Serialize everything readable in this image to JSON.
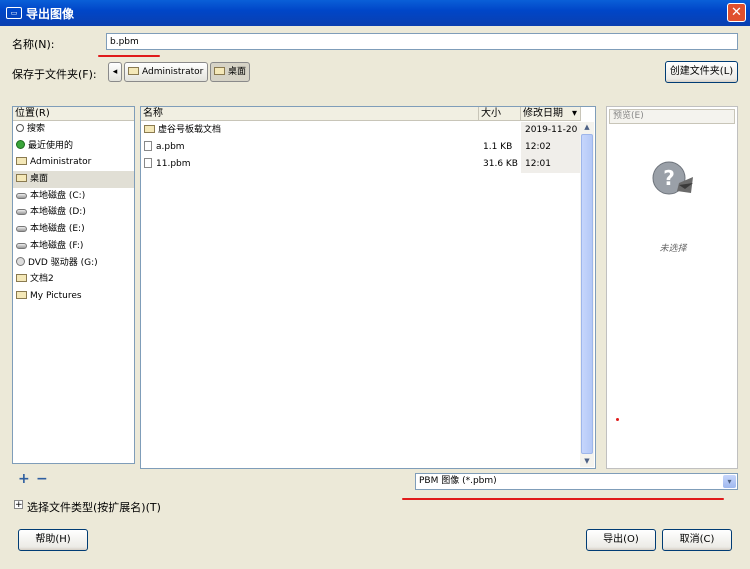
{
  "window": {
    "title": "导出图像",
    "close_glyph": "✕",
    "icon": "dialog-icon"
  },
  "name_label": "名称(N):",
  "name_value": "b.pbm",
  "save_in_label": "保存于文件夹(F):",
  "path": {
    "back_glyph": "◂",
    "items": [
      "Administrator",
      "桌面"
    ]
  },
  "create_folder_label": "创建文件夹(L)",
  "places": {
    "header": "位置(R)",
    "items": [
      {
        "label": "搜索",
        "icon": "search-icon"
      },
      {
        "label": "最近使用的",
        "icon": "recent-icon"
      },
      {
        "label": "Administrator",
        "icon": "folder-icon"
      },
      {
        "label": "桌面",
        "icon": "folder-icon",
        "selected": true
      },
      {
        "label": "本地磁盘 (C:)",
        "icon": "disk-icon"
      },
      {
        "label": "本地磁盘 (D:)",
        "icon": "disk-icon"
      },
      {
        "label": "本地磁盘 (E:)",
        "icon": "disk-icon"
      },
      {
        "label": "本地磁盘 (F:)",
        "icon": "disk-icon"
      },
      {
        "label": "DVD 驱动器 (G:)",
        "icon": "dvd-icon"
      },
      {
        "label": "文档2",
        "icon": "folder-icon"
      },
      {
        "label": "My Pictures",
        "icon": "folder-icon"
      }
    ]
  },
  "files": {
    "headers": {
      "name": "名称",
      "size": "大小",
      "modified": "修改日期",
      "sort_glyph": "▾"
    },
    "rows": [
      {
        "name": "虚谷号板载文档",
        "size": "",
        "modified": "2019-11-20",
        "type": "folder"
      },
      {
        "name": "a.pbm",
        "size": "1.1 KB",
        "modified": "12:02",
        "type": "file"
      },
      {
        "name": "11.pbm",
        "size": "31.6 KB",
        "modified": "12:01",
        "type": "file"
      }
    ]
  },
  "preview": {
    "label": "预览(E)",
    "empty_text": "未选择"
  },
  "add_glyph": "+",
  "remove_glyph": "−",
  "file_type": {
    "value": "PBM 图像 (*.pbm)",
    "arrow": "▾"
  },
  "select_type_label": "选择文件类型(按扩展名)(T)",
  "expander_glyph": "+",
  "buttons": {
    "help": "帮助(H)",
    "export": "导出(O)",
    "cancel": "取消(C)"
  },
  "colors": {
    "titlebar": "#0a4fd0",
    "annotation": "#e01b1b",
    "dialog_bg": "#ece9d8"
  }
}
